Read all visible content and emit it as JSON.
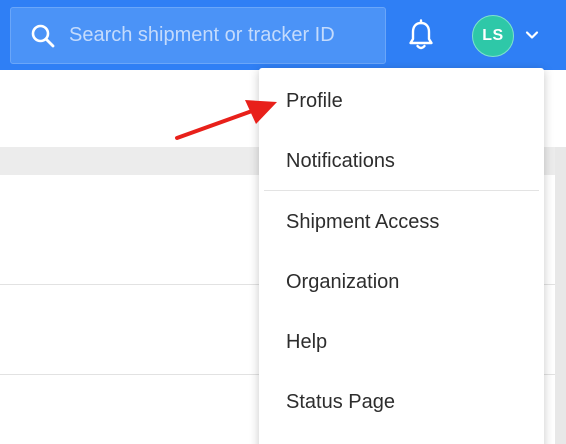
{
  "search": {
    "placeholder": "Search shipment or tracker ID",
    "icon": "search-icon"
  },
  "header": {
    "notifications_icon": "bell-icon",
    "avatar_initials": "LS",
    "menu_toggle_icon": "chevron-down-icon"
  },
  "user_menu": {
    "items": [
      {
        "label": "Profile"
      },
      {
        "label": "Notifications"
      },
      {
        "label": "Shipment Access"
      },
      {
        "label": "Organization"
      },
      {
        "label": "Help"
      },
      {
        "label": "Status Page"
      }
    ]
  },
  "colors": {
    "topbar": "#2f7ff5",
    "search_field": "#4b93f7",
    "avatar": "#2ec8a8",
    "annotation_arrow": "#e8201a"
  }
}
